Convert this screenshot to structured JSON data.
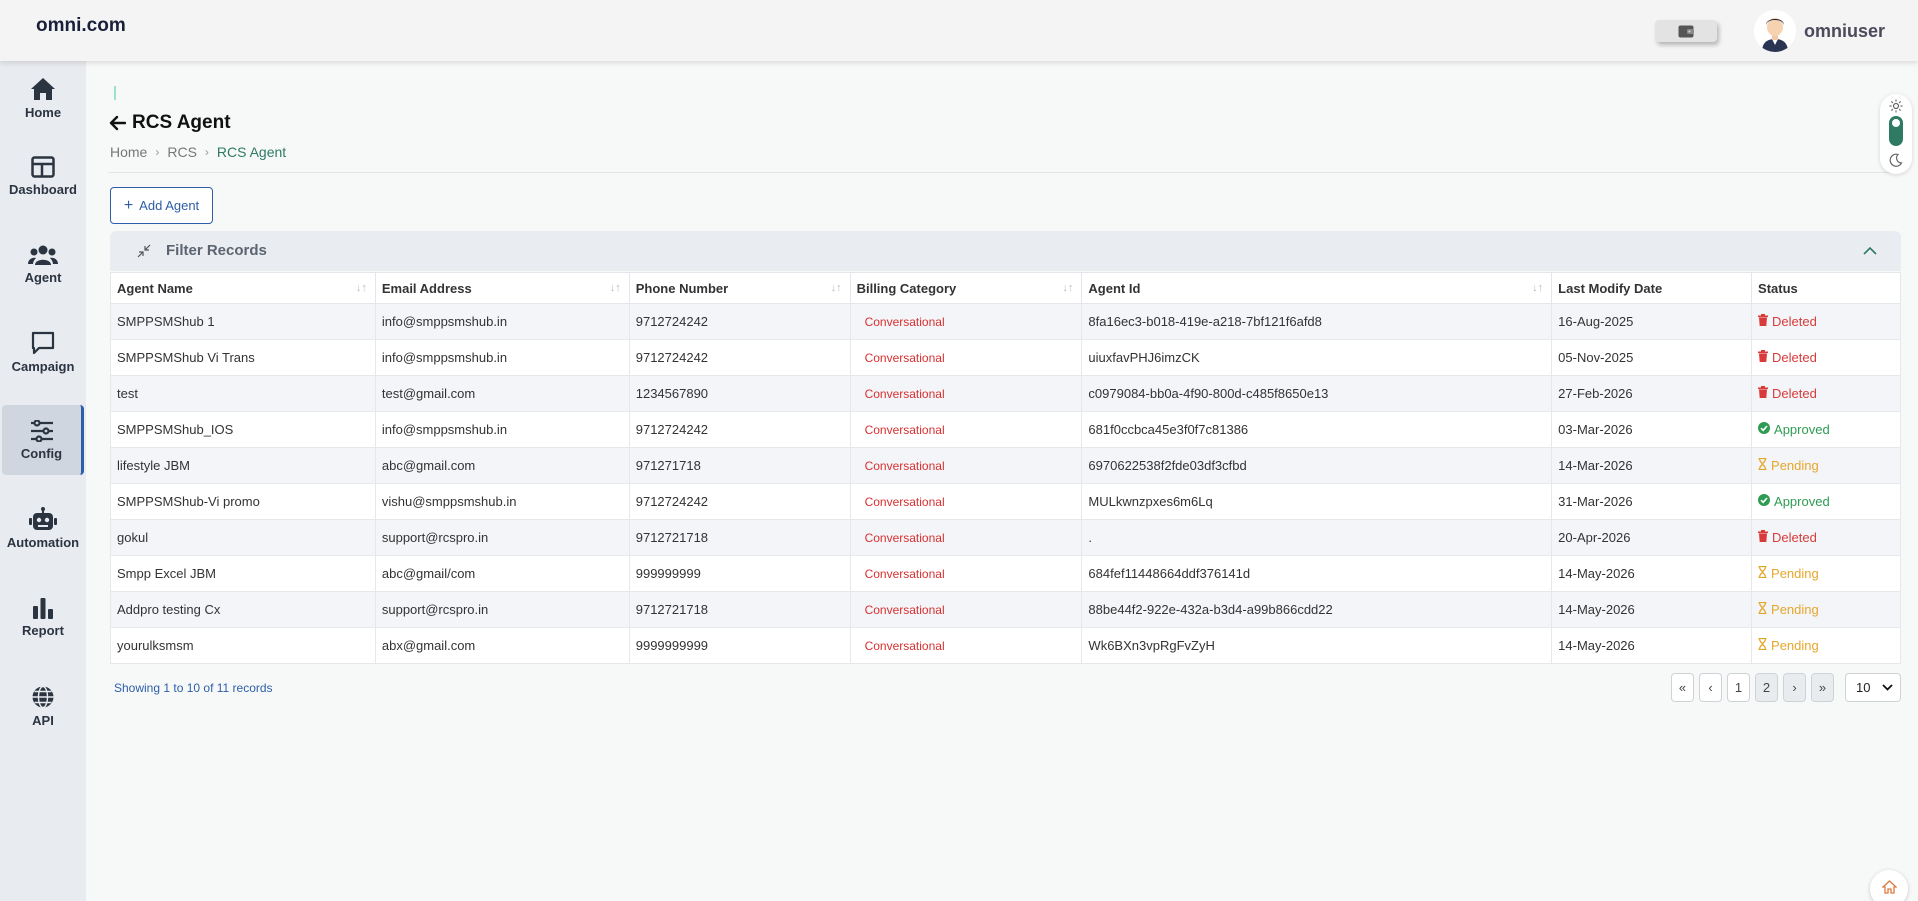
{
  "app": {
    "brand": "omni.com",
    "username": "omniuser"
  },
  "sidebar": {
    "items": [
      {
        "label": "Home",
        "icon": "home-icon"
      },
      {
        "label": "Dashboard",
        "icon": "dashboard-icon"
      },
      {
        "label": "Agent",
        "icon": "users-icon"
      },
      {
        "label": "Campaign",
        "icon": "chat-icon"
      },
      {
        "label": "Config",
        "icon": "sliders-icon",
        "active": true
      },
      {
        "label": "Automation",
        "icon": "robot-icon"
      },
      {
        "label": "Report",
        "icon": "bar-chart-icon"
      },
      {
        "label": "API",
        "icon": "globe-icon"
      }
    ]
  },
  "page": {
    "title": "RCS Agent",
    "breadcrumb": [
      "Home",
      "RCS",
      "RCS Agent"
    ]
  },
  "actions": {
    "add_agent": "Add Agent"
  },
  "filter": {
    "title": "Filter Records"
  },
  "table": {
    "columns": [
      "Agent Name",
      "Email Address",
      "Phone Number",
      "Billing Category",
      "Agent Id",
      "Last Modify Date",
      "Status"
    ],
    "rows": [
      {
        "name": "SMPPSMShub 1",
        "email": "info@smppsmshub.in",
        "phone": "9712724242",
        "billing": "Conversational",
        "agent_id": "8fa16ec3-b018-419e-a218-7bf121f6afd8",
        "date": "16-Aug-2025",
        "status": "Deleted"
      },
      {
        "name": "SMPPSMShub Vi Trans",
        "email": "info@smppsmshub.in",
        "phone": "9712724242",
        "billing": "Conversational",
        "agent_id": "uiuxfavPHJ6imzCK",
        "date": "05-Nov-2025",
        "status": "Deleted"
      },
      {
        "name": "test",
        "email": "test@gmail.com",
        "phone": "1234567890",
        "billing": "Conversational",
        "agent_id": "c0979084-bb0a-4f90-800d-c485f8650e13",
        "date": "27-Feb-2026",
        "status": "Deleted"
      },
      {
        "name": "SMPPSMShub_IOS",
        "email": "info@smppsmshub.in",
        "phone": "9712724242",
        "billing": "Conversational",
        "agent_id": "681f0ccbca45e3f0f7c81386",
        "date": "03-Mar-2026",
        "status": "Approved"
      },
      {
        "name": "lifestyle JBM",
        "email": "abc@gmail.com",
        "phone": "971271718",
        "billing": "Conversational",
        "agent_id": "6970622538f2fde03df3cfbd",
        "date": "14-Mar-2026",
        "status": "Pending"
      },
      {
        "name": "SMPPSMShub-Vi promo",
        "email": "vishu@smppsmshub.in",
        "phone": "9712724242",
        "billing": "Conversational",
        "agent_id": "MULkwnzpxes6m6Lq",
        "date": "31-Mar-2026",
        "status": "Approved"
      },
      {
        "name": "gokul",
        "email": "support@rcspro.in",
        "phone": "9712721718",
        "billing": "Conversational",
        "agent_id": ".",
        "date": "20-Apr-2026",
        "status": "Deleted"
      },
      {
        "name": "Smpp Excel JBM",
        "email": "abc@gmail/com",
        "phone": "999999999",
        "billing": "Conversational",
        "agent_id": "684fef11448664ddf376141d",
        "date": "14-May-2026",
        "status": "Pending"
      },
      {
        "name": "Addpro testing Cx",
        "email": "support@rcspro.in",
        "phone": "9712721718",
        "billing": "Conversational",
        "agent_id": "88be44f2-922e-432a-b3d4-a99b866cdd22",
        "date": "14-May-2026",
        "status": "Pending"
      },
      {
        "name": "yourulksmsm",
        "email": "abx@gmail.com",
        "phone": "9999999999",
        "billing": "Conversational",
        "agent_id": "Wk6BXn3vpRgFvZyH",
        "date": "14-May-2026",
        "status": "Pending"
      }
    ]
  },
  "pagination": {
    "summary": "Showing 1 to 10 of 11 records",
    "first": "«",
    "prev": "‹",
    "pages": [
      "1",
      "2"
    ],
    "current": "2",
    "next": "›",
    "last": "»",
    "page_size": "10"
  },
  "colors": {
    "accent": "#2e5ea8",
    "green": "#2f7a63",
    "deleted": "#d93b3b",
    "approved": "#2e9c52",
    "pending": "#e5a72b"
  }
}
